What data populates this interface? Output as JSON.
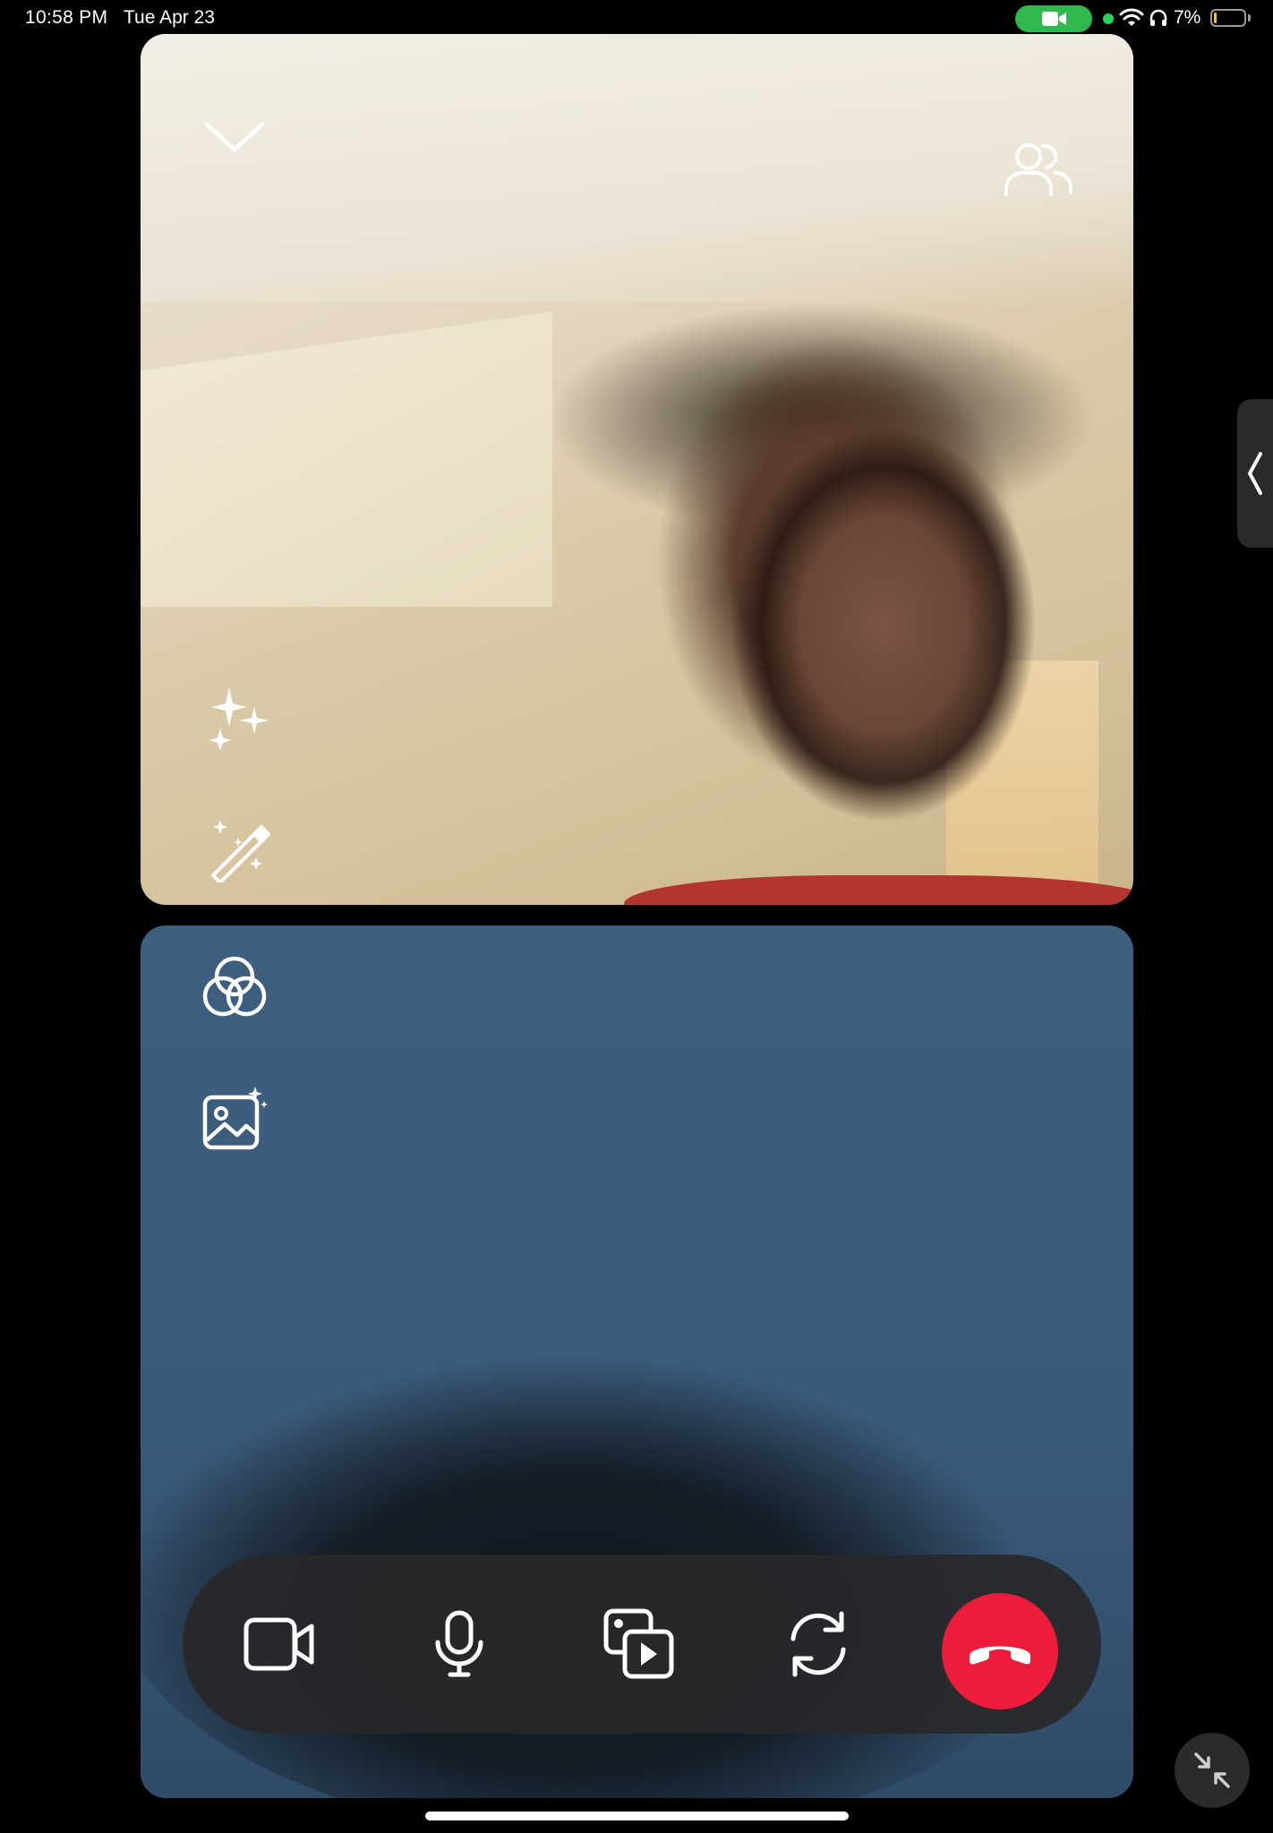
{
  "status_bar": {
    "time": "10:58 PM",
    "date": "Tue Apr 23",
    "battery_percent": "7%",
    "battery_level": 0.07,
    "camera_indicator_color": "#2fb84e",
    "icons": [
      "video-camera-icon",
      "wifi-icon",
      "headphones-icon",
      "battery-icon"
    ]
  },
  "remote_video": {
    "controls": [
      "chevron-down-icon",
      "participants-icon",
      "sparkles-icon",
      "magic-wand-icon"
    ]
  },
  "local_video": {
    "controls": [
      "filters-icon",
      "background-image-icon"
    ]
  },
  "call_controls": {
    "buttons": [
      "camera-icon",
      "microphone-icon",
      "share-media-icon",
      "flip-camera-icon",
      "end-call-icon"
    ],
    "end_call_color": "#ec1c3a"
  },
  "side_panel": {
    "icon": "chevron-left-icon"
  },
  "minimize": {
    "icon": "minimize-arrows-icon"
  }
}
